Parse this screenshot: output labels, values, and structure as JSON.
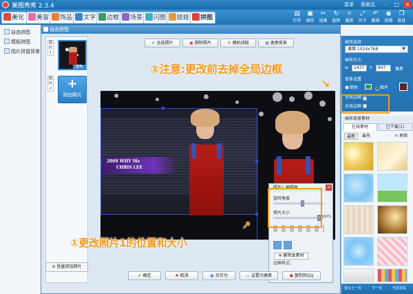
{
  "app": {
    "title": "美图秀秀 2.3.4",
    "links": [
      "菜单",
      "帮助见"
    ]
  },
  "window_buttons": [
    "-",
    "□",
    "×"
  ],
  "tabs": [
    {
      "label": "美化",
      "color": "#e0493b"
    },
    {
      "label": "美容",
      "color": "#e46cb0"
    },
    {
      "label": "饰品",
      "color": "#e9803a"
    },
    {
      "label": "文字",
      "color": "#3b82d4"
    },
    {
      "label": "边框",
      "color": "#3a9d5d"
    },
    {
      "label": "场景",
      "color": "#8c63c6"
    },
    {
      "label": "闪图",
      "color": "#3bb0c8"
    },
    {
      "label": "娃娃",
      "color": "#e29a3c"
    },
    {
      "label": "拼图",
      "color": "#d9433a"
    }
  ],
  "toolbar_right": [
    {
      "icon": "open",
      "label": "打开"
    },
    {
      "icon": "save",
      "label": "保存"
    },
    {
      "icon": "crop",
      "label": "抠图"
    },
    {
      "icon": "rotate",
      "label": "旋转"
    },
    {
      "icon": "cut",
      "label": "裁剪"
    },
    {
      "icon": "size",
      "label": "尺寸"
    },
    {
      "icon": "undo",
      "label": "撤销"
    },
    {
      "icon": "photo",
      "label": "拍照"
    },
    {
      "icon": "batch",
      "label": "批处理"
    }
  ],
  "left_menu": [
    "自由拼图",
    "模板拼图",
    "图片拼接背景"
  ],
  "dialog": {
    "title": "自由拼图",
    "photo1_num": "照片1",
    "photo2_num": "照片2",
    "thumb_badge": "替换",
    "add_photo": "添加照片",
    "batch_add": "批量添加照片",
    "top_buttons": [
      "全选照片",
      "删除照片",
      "随机排版",
      "更换背景"
    ],
    "bottom_buttons": [
      "确定",
      "取消",
      "另存为",
      "设置为桌面",
      "复制到QQ"
    ],
    "canvas_text_1": "2009 WHY Me",
    "canvas_text_2": "CHRIS LEE"
  },
  "edit_popup": {
    "title": "照片1 编辑框",
    "rotate_label": "旋转角度",
    "size_label": "照片大小",
    "size_value": "200%",
    "rotate_level": 0.6,
    "size_level": 0.95,
    "border_label": "边框样式：",
    "delete_label": "删除本素材"
  },
  "right_panel": {
    "canvas_select_label": "画布选择",
    "canvas_select_value": "桌面   1024x768",
    "canvas_size_label": "画布大小",
    "width": "1437",
    "height": "847",
    "size_btn": "像素",
    "bg_label": "背景设置",
    "color_option": "颜色",
    "image_option": "图片",
    "transparent_label": "全局边缘",
    "global_border_label": "全局边框",
    "section_label": "画布背景素材",
    "tab_online": "在线素材",
    "tab_downloaded": "已下载(1)",
    "sub_tabs": [
      "最新",
      "最热"
    ],
    "refresh": "刷新",
    "footer": [
      "显示上一页",
      "下一页",
      "当前页码"
    ]
  },
  "annotations": {
    "note_top": "②注意:更改前去掉全局边框",
    "note_bottom": "①更改照片1的位置和大小",
    "accent": "#f39a1e"
  }
}
